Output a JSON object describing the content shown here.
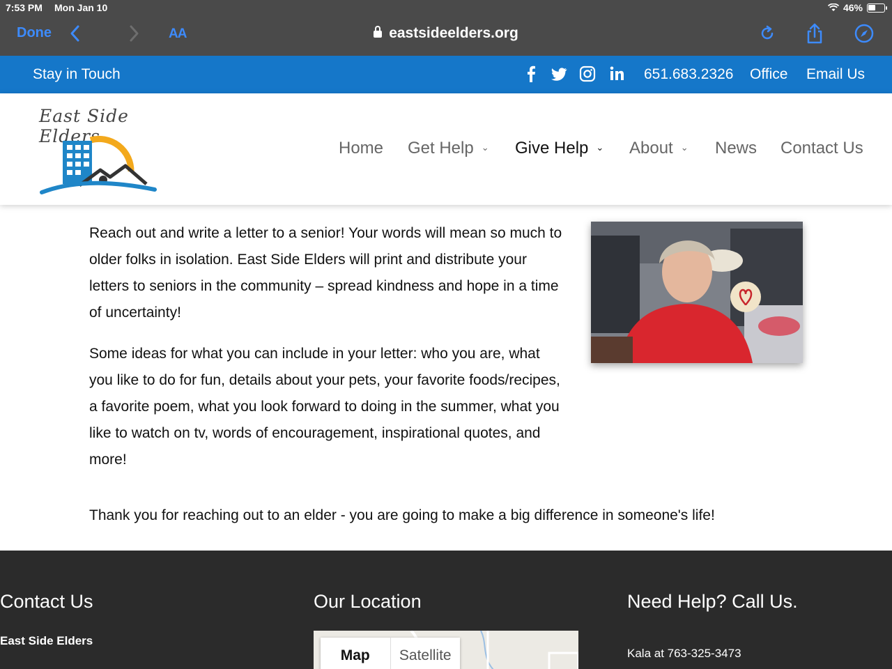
{
  "status_bar": {
    "time": "7:53 PM",
    "date": "Mon Jan 10",
    "battery": "46%"
  },
  "browser": {
    "done_label": "Done",
    "aa_label": "AA",
    "url": "eastsideelders.org"
  },
  "topbar": {
    "stay_label": "Stay in Touch",
    "phone": "651.683.2326",
    "office_label": "Office",
    "email_label": "Email Us",
    "social_icons": [
      "facebook-icon",
      "twitter-icon",
      "instagram-icon",
      "linkedin-icon"
    ]
  },
  "logo": {
    "text": "East Side Elders"
  },
  "nav": {
    "home": "Home",
    "get_help": "Get Help",
    "give_help": "Give Help",
    "about": "About",
    "news": "News",
    "contact": "Contact Us"
  },
  "main": {
    "paragraph1": "Reach out and write a letter to a senior!  Your words will mean so much to older folks in isolation.  East Side Elders will print and distribute your letters to seniors in the community – spread kindness and hope in a time of uncertainty!",
    "paragraph2": "Some ideas for what you can include in your letter:  who you are, what you like to do for fun, details about your pets, your favorite foods/recipes, a favorite poem, what you look forward to doing in the summer, what you like to watch on tv, words of encouragement, inspirational quotes, and more!",
    "thanks": "Thank you for reaching out to an elder - you are going to make a big difference in someone's life!"
  },
  "footer": {
    "contact_title": "Contact Us",
    "org_name": "East Side Elders",
    "location_title": "Our Location",
    "map_tab": "Map",
    "satellite_tab": "Satellite",
    "help_title": "Need Help?  Call Us.",
    "kala": "Kala at 763-325-3473"
  },
  "colors": {
    "topbar": "#1577c9",
    "footer": "#2b2b2b",
    "ios_blue": "#3d8bfd"
  }
}
